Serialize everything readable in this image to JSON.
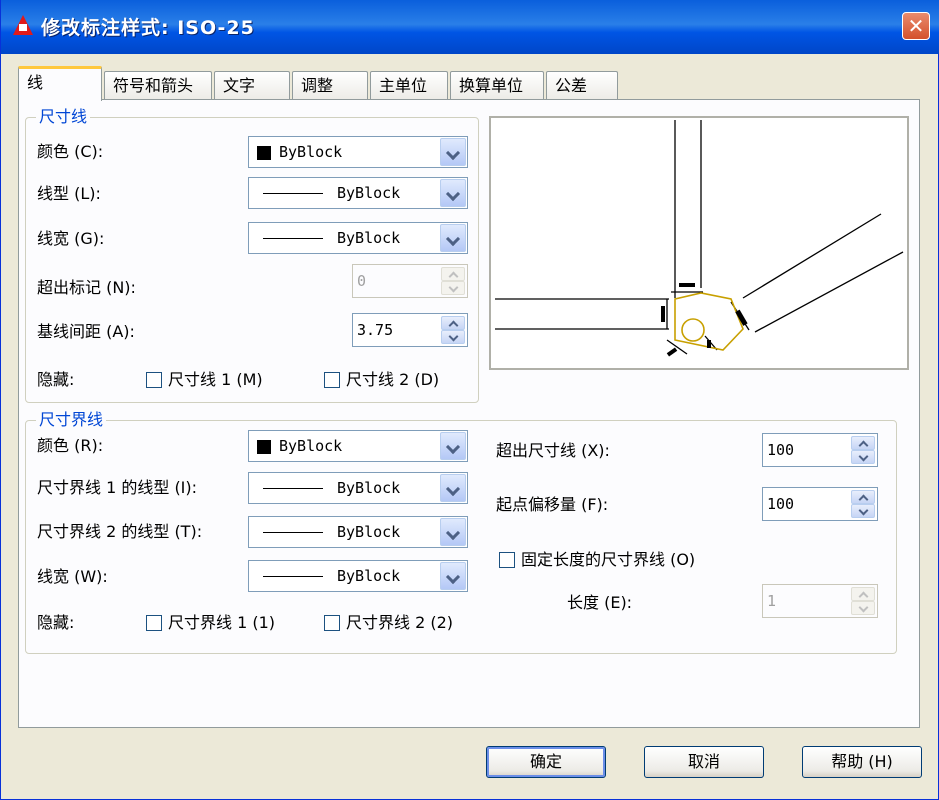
{
  "window": {
    "title": "修改标注样式: ISO-25",
    "close": "✕"
  },
  "tabs": [
    "线",
    "符号和箭头",
    "文字",
    "调整",
    "主单位",
    "换算单位",
    "公差"
  ],
  "dim_line": {
    "group_title": "尺寸线",
    "color_label": "颜色 (C):",
    "color_value": "ByBlock",
    "linetype_label": "线型 (L):",
    "linetype_value": "ByBlock",
    "lineweight_label": "线宽 (G):",
    "lineweight_value": "ByBlock",
    "extend_ticks_label": "超出标记 (N):",
    "extend_ticks_value": "0",
    "baseline_spacing_label": "基线间距 (A):",
    "baseline_spacing_value": "3.75",
    "suppress_label": "隐藏:",
    "suppress1_label": "尺寸线 1 (M)",
    "suppress2_label": "尺寸线 2 (D)"
  },
  "ext_line": {
    "group_title": "尺寸界线",
    "color_label": "颜色 (R):",
    "color_value": "ByBlock",
    "linetype1_label": "尺寸界线 1 的线型 (I):",
    "linetype1_value": "ByBlock",
    "linetype2_label": "尺寸界线 2 的线型 (T):",
    "linetype2_value": "ByBlock",
    "lineweight_label": "线宽 (W):",
    "lineweight_value": "ByBlock",
    "suppress_label": "隐藏:",
    "suppress1_label": "尺寸界线 1 (1)",
    "suppress2_label": "尺寸界线 2 (2)",
    "extend_beyond_label": "超出尺寸线 (X):",
    "extend_beyond_value": "100",
    "offset_label": "起点偏移量 (F):",
    "offset_value": "100",
    "fixed_length_label": "固定长度的尺寸界线 (O)",
    "length_label": "长度 (E):",
    "length_value": "1"
  },
  "buttons": {
    "ok": "确定",
    "cancel": "取消",
    "help": "帮助 (H)"
  },
  "colors": {
    "title_bar": "#0a5fdc",
    "group_title": "#0046d5",
    "preview_highlight": "#c8a000"
  }
}
